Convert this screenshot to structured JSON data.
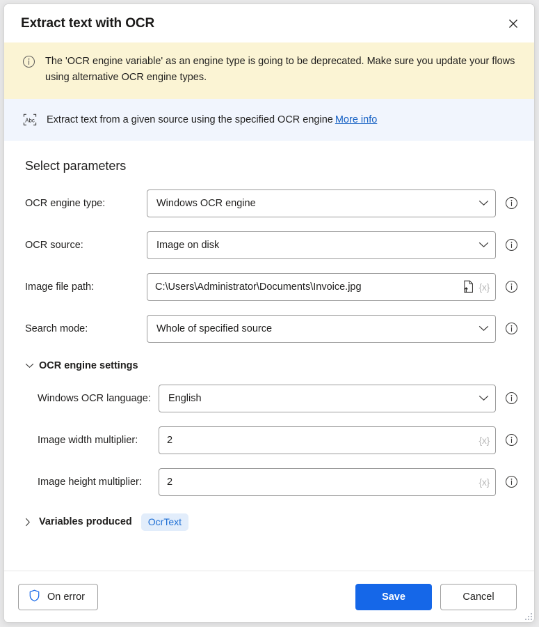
{
  "window": {
    "title": "Extract text with OCR",
    "close_label": "×",
    "close_icon": "close-icon"
  },
  "warning_banner": {
    "icon": "info-circle-icon",
    "text": "The 'OCR engine variable' as an engine type is going to be deprecated.  Make sure you update your flows using alternative OCR engine types.",
    "background": "#fbf4d4"
  },
  "description_banner": {
    "icon": "abc-ocr-icon",
    "text": "Extract text from a given source using the specified OCR engine",
    "link_label": "More info",
    "background": "#f1f5fd",
    "link_color": "#1661c4"
  },
  "main": {
    "section_title": "Select parameters",
    "fields": [
      {
        "label": "OCR engine type:",
        "value": "Windows OCR engine",
        "control": "dropdown",
        "info_icon": "info-icon"
      },
      {
        "label": "OCR source:",
        "value": "Image on disk",
        "control": "dropdown",
        "info_icon": "info-icon"
      },
      {
        "label": "Image file path:",
        "value": "C:\\Users\\Administrator\\Documents\\Invoice.jpg",
        "control": "textbox",
        "file_picker_icon": "file-upload-icon",
        "variable_glyph": "{x}",
        "info_icon": "info-icon"
      },
      {
        "label": "Search mode:",
        "value": "Whole of specified source",
        "control": "dropdown",
        "info_icon": "info-icon"
      }
    ],
    "engine_settings": {
      "label": "OCR engine settings",
      "expanded": true,
      "caret_icon": "chevron-down-icon",
      "fields": [
        {
          "label": "Windows OCR language:",
          "value": "English",
          "control": "dropdown",
          "info_icon": "info-icon"
        },
        {
          "label": "Image width multiplier:",
          "value": "2",
          "control": "textbox",
          "variable_glyph": "{x}",
          "info_icon": "info-icon"
        },
        {
          "label": "Image height multiplier:",
          "value": "2",
          "control": "textbox",
          "variable_glyph": "{x}",
          "info_icon": "info-icon"
        }
      ]
    },
    "variables_produced": {
      "label": "Variables produced",
      "expanded": false,
      "caret_icon": "chevron-right-icon",
      "chip": "OcrText",
      "chip_bg": "#e2edfb",
      "chip_color": "#1f6fd4"
    }
  },
  "footer": {
    "on_error_label": "On error",
    "on_error_icon": "shield-icon",
    "save_label": "Save",
    "cancel_label": "Cancel",
    "save_color": "#1567e8"
  }
}
